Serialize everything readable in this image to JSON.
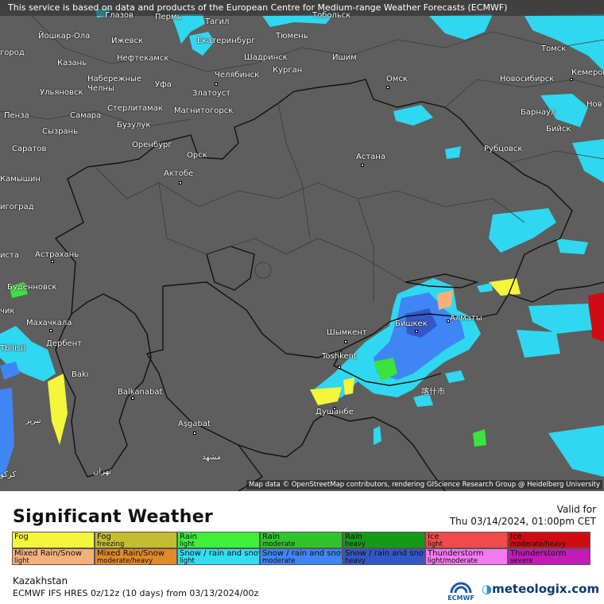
{
  "notice": "This service is based on data and products of the European Centre for Medium-range Weather Forecasts (ECMWF)",
  "attribution": "Map data © OpenStreetMap contributors, rendering GIScience Research Group @ Heidelberg University",
  "colors": {
    "map_background": "#5e5e5e",
    "border": "#111111",
    "snow_light": "#2fd8f0",
    "snow_moderate": "#3f86f4",
    "snow_heavy": "#3a5fd0",
    "rain_light": "#39e43d",
    "fog": "#f5f53a",
    "mixed_light": "#f4b07a"
  },
  "cities": [
    {
      "name": "Глазов"
    },
    {
      "name": "Пермь"
    },
    {
      "name": "Тагил"
    },
    {
      "name": "Тобольск"
    },
    {
      "name": "Йошкар-Ола"
    },
    {
      "name": "Ижевск"
    },
    {
      "name": "Екатеринбург"
    },
    {
      "name": "Тюмень"
    },
    {
      "name": "город"
    },
    {
      "name": "Нефтекамск"
    },
    {
      "name": "Шадринск"
    },
    {
      "name": "Ишим"
    },
    {
      "name": "Томск"
    },
    {
      "name": "Казань"
    },
    {
      "name": "Набережные Челны"
    },
    {
      "name": "Курган"
    },
    {
      "name": "Кемеров"
    },
    {
      "name": "Ульяновск"
    },
    {
      "name": "Уфа"
    },
    {
      "name": "Челябинск"
    },
    {
      "name": "Омск"
    },
    {
      "name": "Новосибирск"
    },
    {
      "name": "Стерлитамак"
    },
    {
      "name": "Златоуст"
    },
    {
      "name": "Нов"
    },
    {
      "name": "Пенза"
    },
    {
      "name": "Самара"
    },
    {
      "name": "Магнитогорск"
    },
    {
      "name": "Барнаул"
    },
    {
      "name": "Сызрань"
    },
    {
      "name": "Бузулук"
    },
    {
      "name": "Бийск"
    },
    {
      "name": "Саратов"
    },
    {
      "name": "Оренбург"
    },
    {
      "name": "Рубцовск"
    },
    {
      "name": "Орск"
    },
    {
      "name": "Астана"
    },
    {
      "name": "Актобе"
    },
    {
      "name": "Камышин"
    },
    {
      "name": "игоград"
    },
    {
      "name": "иста"
    },
    {
      "name": "Астрахань"
    },
    {
      "name": "Будённовск"
    },
    {
      "name": "чик"
    },
    {
      "name": "Махачкала"
    },
    {
      "name": "Бишкек"
    },
    {
      "name": "Алматы"
    },
    {
      "name": "Шымкент"
    },
    {
      "name": "Tbilisi)"
    },
    {
      "name": "Дербент"
    },
    {
      "name": "Toshkent"
    },
    {
      "name": "Bakı"
    },
    {
      "name": "Balkanabat"
    },
    {
      "name": "喀什市"
    },
    {
      "name": "Душанбе"
    },
    {
      "name": "Aşgabat"
    },
    {
      "name": "مشهد"
    },
    {
      "name": "تهران"
    },
    {
      "name": "تبریز"
    },
    {
      "name": "کرکو"
    }
  ],
  "panel": {
    "title": "Significant Weather",
    "valid_label": "Valid for",
    "valid_time": "Thu 03/14/2024, 01:00pm CET",
    "region": "Kazakhstan",
    "model": "ECMWF IFS HRES 0z/12z (10 days) from  03/13/2024/00z",
    "ecmwf_logo_text": "ECMWF",
    "brand": "meteologix.com"
  },
  "legend": [
    {
      "line1": "Fog",
      "line2": "",
      "color": "#f5f53a"
    },
    {
      "line1": "Fog",
      "line2": "freezing",
      "color": "#c4bd2f"
    },
    {
      "line1": "Rain",
      "line2": "light",
      "color": "#3ef03a"
    },
    {
      "line1": "Rain",
      "line2": "moderate",
      "color": "#2fc42b"
    },
    {
      "line1": "Rain",
      "line2": "heavy",
      "color": "#159a17"
    },
    {
      "line1": "Ice",
      "line2": "light",
      "color": "#f24a4a"
    },
    {
      "line1": "Ice",
      "line2": "moderate/heavy",
      "color": "#cf0c14"
    },
    {
      "line1": "Mixed Rain/Snow",
      "line2": "light",
      "color": "#f5b07a"
    },
    {
      "line1": "Mixed Rain/Snow",
      "line2": "moderate/heavy",
      "color": "#e08a2a"
    },
    {
      "line1": "Snow / rain and snow",
      "line2": "light",
      "color": "#34def2"
    },
    {
      "line1": "Snow / rain and snow",
      "line2": "moderate",
      "color": "#3f86f4"
    },
    {
      "line1": "Snow / rain and snow",
      "line2": "heavy",
      "color": "#3457c8"
    },
    {
      "line1": "Thunderstorm",
      "line2": "light/moderate",
      "color": "#f47af0"
    },
    {
      "line1": "Thunderstorm",
      "line2": "severe",
      "color": "#c41ab8"
    }
  ]
}
